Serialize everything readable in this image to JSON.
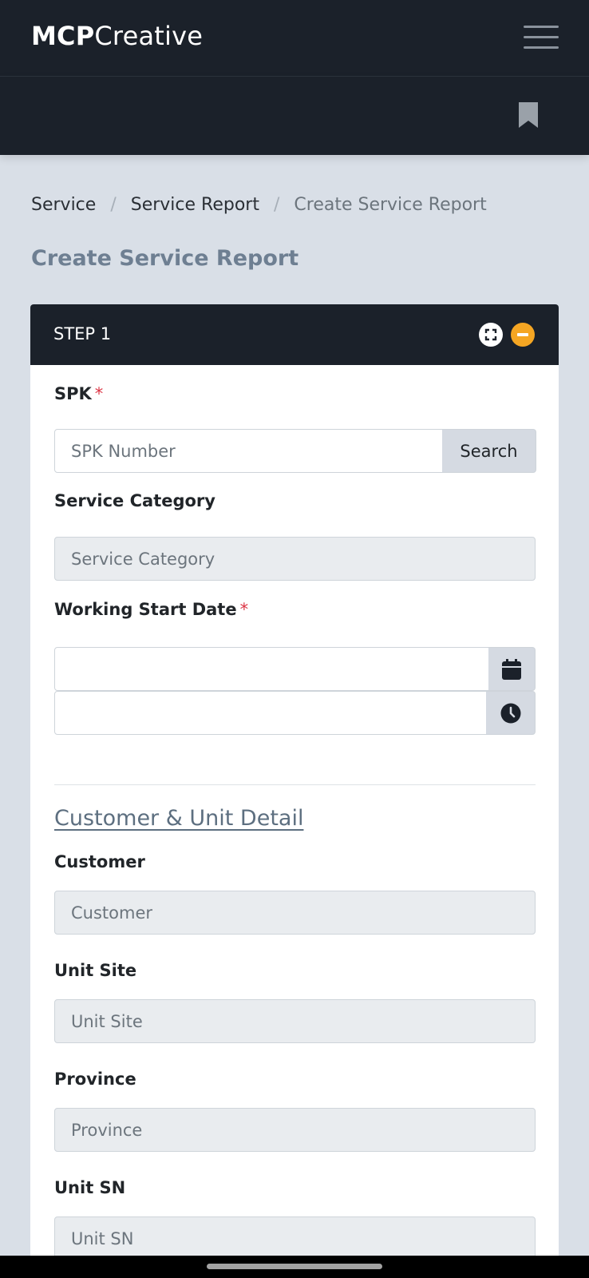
{
  "app": {
    "brand_bold": "MCP",
    "brand_regular": "Creative"
  },
  "breadcrumb": [
    "Service",
    "Service Report",
    "Create Service Report"
  ],
  "page_title": "Create Service Report",
  "card": {
    "header_title": "STEP 1",
    "fields": {
      "spk": {
        "label": "SPK",
        "required_mark": "*",
        "placeholder": "SPK Number",
        "button": "Search"
      },
      "service_category": {
        "label": "Service Category",
        "placeholder": "Service Category"
      },
      "working_start_date": {
        "label": "Working Start Date",
        "required_mark": "*",
        "date_value": "",
        "time_value": ""
      }
    },
    "section_title": "Customer & Unit Detail",
    "customer_fields": {
      "customer": {
        "label": "Customer",
        "placeholder": "Customer"
      },
      "unit_site": {
        "label": "Unit Site",
        "placeholder": "Unit Site"
      },
      "province": {
        "label": "Province",
        "placeholder": "Province"
      },
      "unit_sn": {
        "label": "Unit SN",
        "placeholder": "Unit SN"
      }
    }
  },
  "colors": {
    "navbar": "#1b212a",
    "background": "#d9dfe7",
    "accent_orange": "#f5a623",
    "required": "#dc3545",
    "title_muted": "#6e7f92"
  },
  "icons": {
    "menu": "hamburger-menu-icon",
    "bookmark": "bookmark-icon",
    "expand": "expand-icon",
    "collapse": "minus-icon",
    "date": "calendar-icon",
    "time": "clock-icon"
  }
}
